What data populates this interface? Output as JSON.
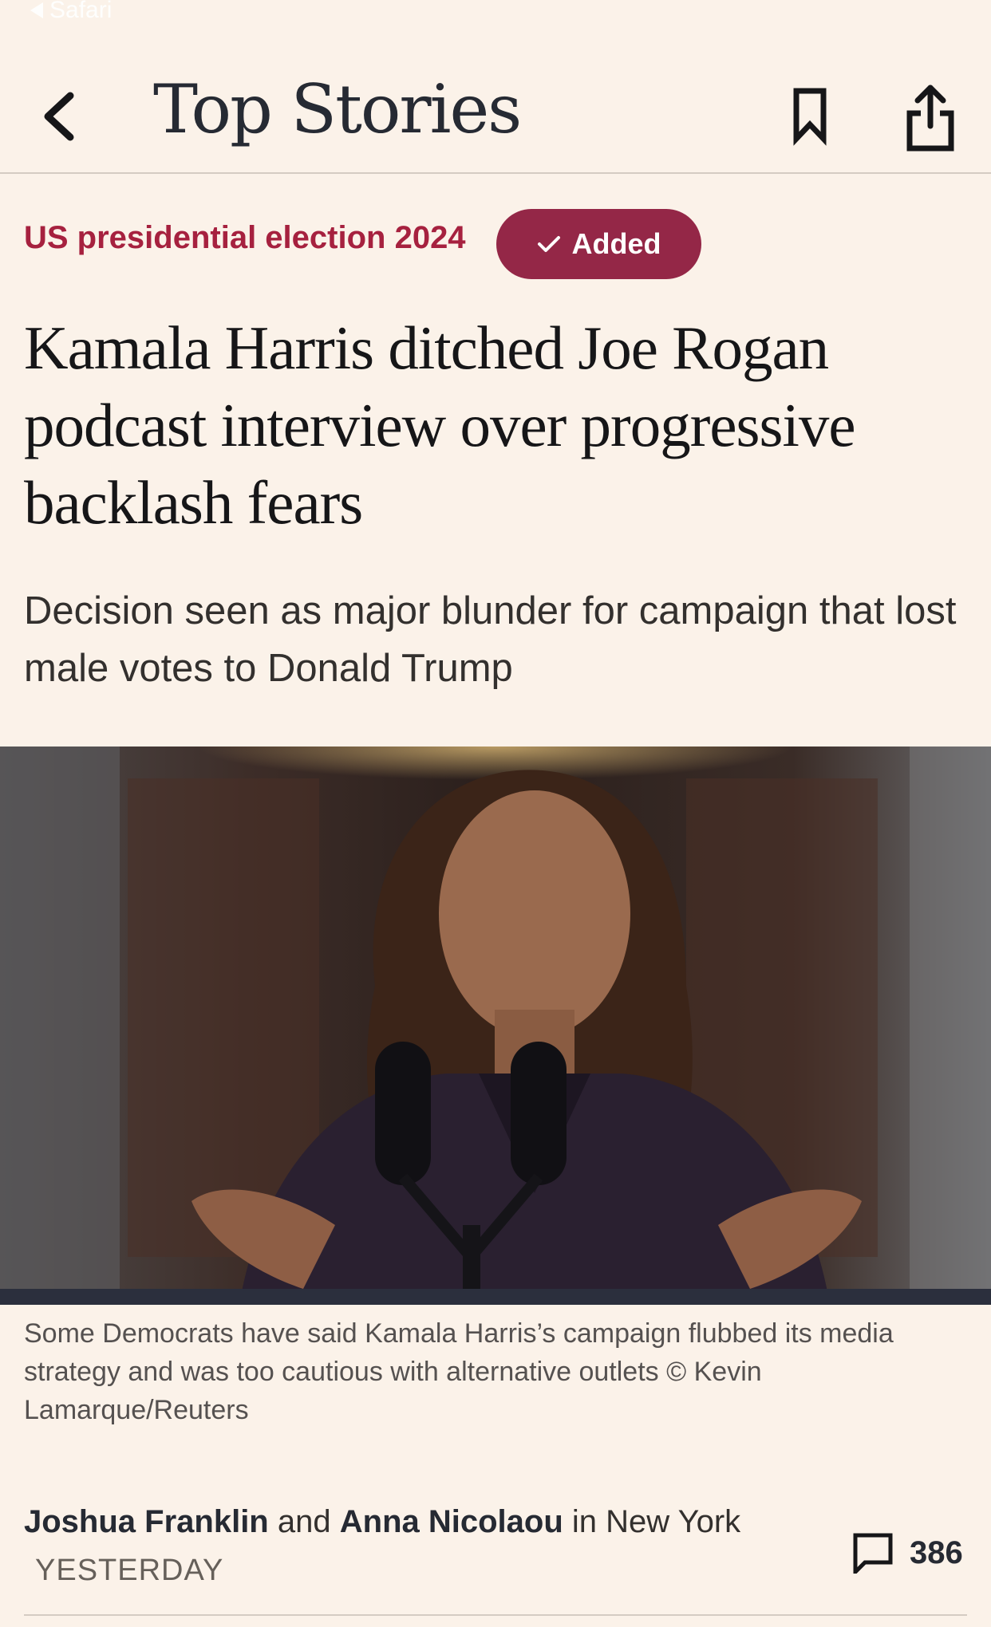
{
  "status_bar": {
    "back_app_label": "Safari"
  },
  "nav": {
    "title": "Top Stories"
  },
  "article": {
    "topic": "US presidential election 2024",
    "follow_label": "Added",
    "headline": "Kamala Harris ditched Joe Rogan podcast interview over progressive backlash fears",
    "standfirst": "Decision seen as major blunder for campaign that lost male votes to Donald Trump",
    "image_caption": "Some Democrats have said Kamala Harris’s campaign flubbed its media strategy and was too cautious with alternative outlets © Kevin Lamarque/Reuters",
    "byline": {
      "author1": "Joshua Franklin",
      "joiner": "and",
      "author2": "Anna Nicolaou",
      "location": "in New York"
    },
    "date": "YESTERDAY",
    "comment_count": "386"
  },
  "colors": {
    "background": "#fbf2e9",
    "accent": "#a6213f",
    "button_fill": "#942747",
    "text": "#262a33"
  },
  "icons": [
    "back-chevron-icon",
    "bookmark-icon",
    "share-icon",
    "checkmark-icon",
    "comment-icon"
  ]
}
